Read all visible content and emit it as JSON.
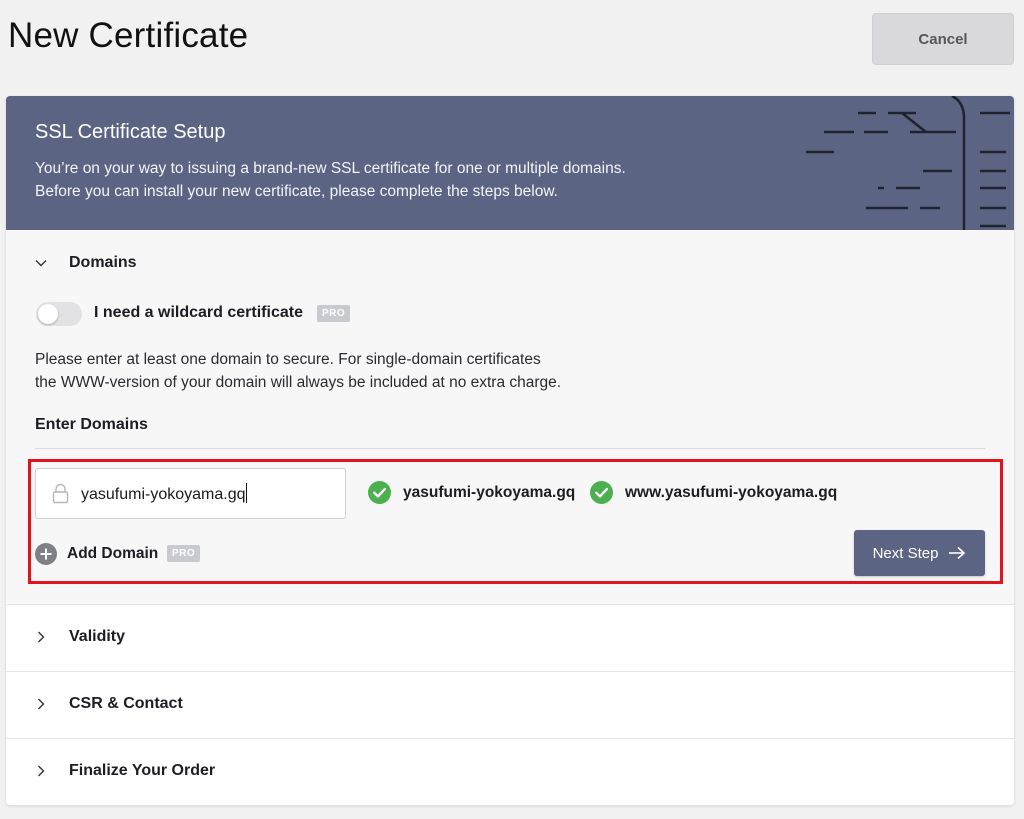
{
  "page": {
    "title": "New Certificate",
    "cancel_label": "Cancel"
  },
  "banner": {
    "title": "SSL Certificate Setup",
    "line1": "You’re on your way to issuing a brand-new SSL certificate for one or multiple domains.",
    "line2": "Before you can install your new certificate, please complete the steps below."
  },
  "domains": {
    "section_label": "Domains",
    "wildcard_label": "I need a wildcard certificate",
    "wildcard_enabled": false,
    "pro_badge": "PRO",
    "help_line1": "Please enter at least one domain to secure. For single-domain certificates",
    "help_line2": "the WWW-version of your domain will always be included at no extra charge.",
    "enter_label": "Enter Domains",
    "input_value": "yasufumi-yokoyama.gq",
    "validated": [
      {
        "name": "yasufumi-yokoyama.gq"
      },
      {
        "name": "www.yasufumi-yokoyama.gq"
      }
    ],
    "add_domain_label": "Add Domain",
    "next_step_label": "Next Step"
  },
  "sections": [
    {
      "label": "Validity"
    },
    {
      "label": "CSR & Contact"
    },
    {
      "label": "Finalize Your Order"
    }
  ],
  "colors": {
    "banner_bg": "#5b6482",
    "success_green": "#4caf50",
    "highlight_red": "#e0141c"
  }
}
